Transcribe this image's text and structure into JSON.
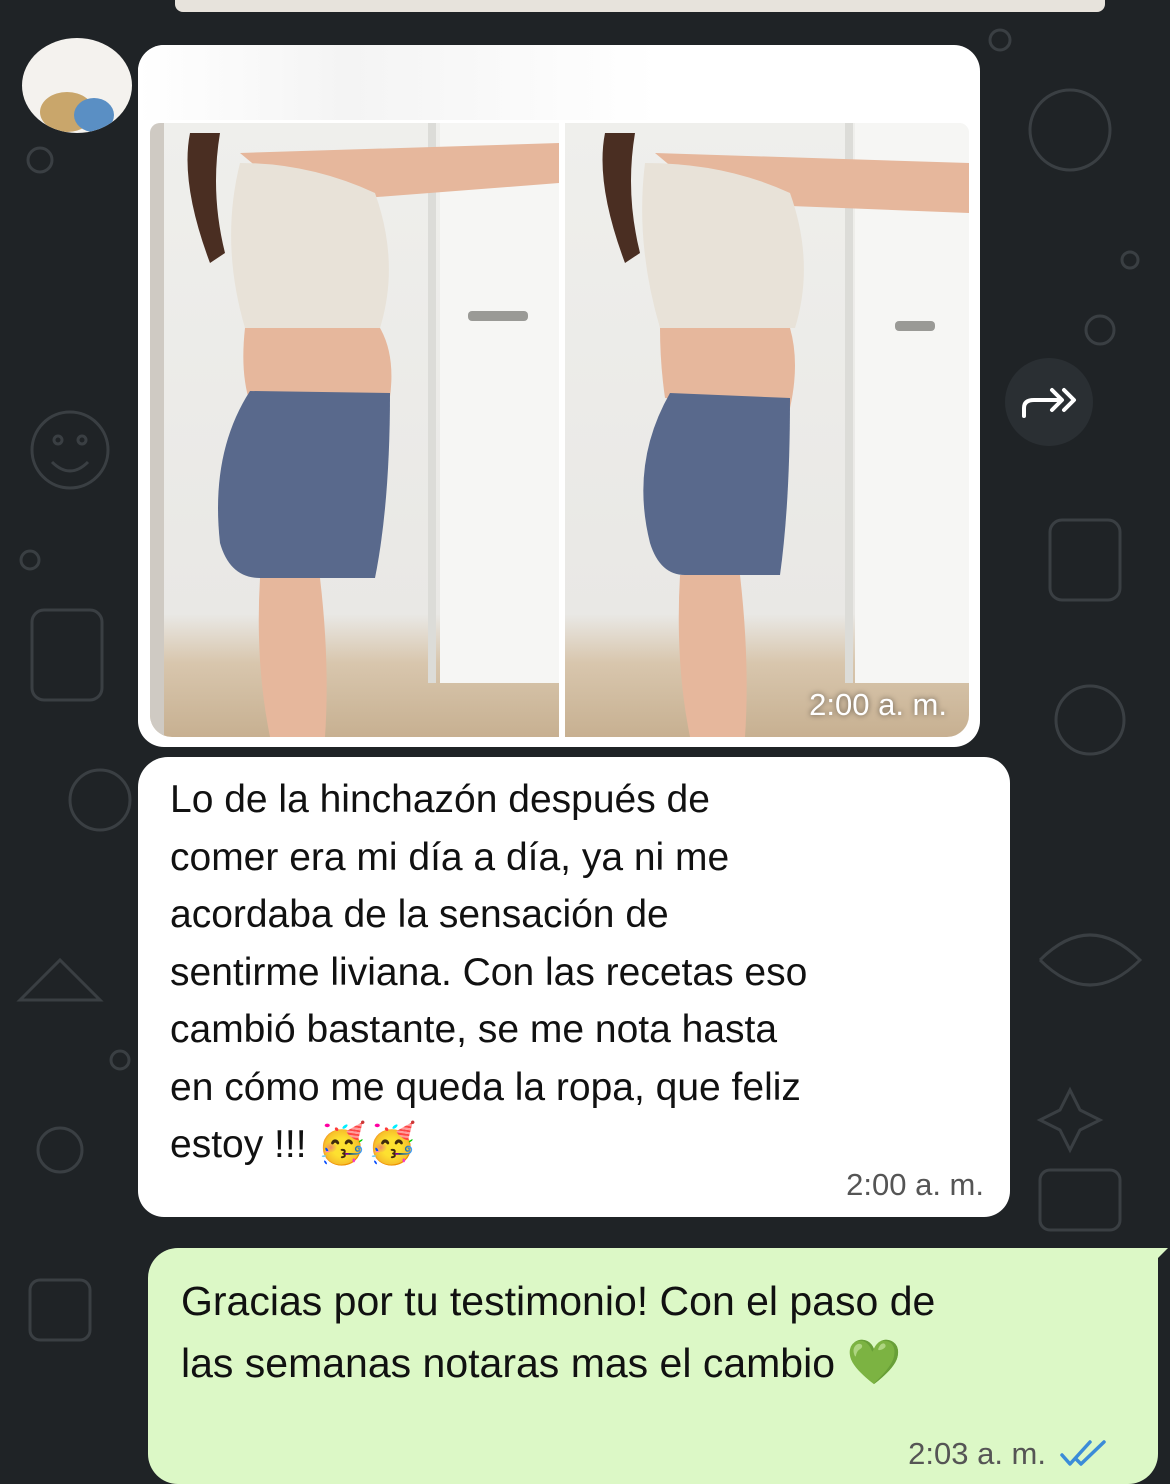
{
  "media_message": {
    "timestamp": "2:00 a. m."
  },
  "incoming_message": {
    "lines": [
      "Lo de la hinchazón después de",
      "comer era mi día a día, ya ni me",
      "acordaba de la sensación de",
      "sentirme liviana. Con las recetas eso",
      "cambió bastante, se me nota hasta",
      "en cómo me queda la ropa, que feliz",
      "estoy !!!"
    ],
    "emoji": "🥳🥳",
    "timestamp": "2:00 a. m."
  },
  "outgoing_message": {
    "lines": [
      "Gracias por tu testimonio! Con el paso de",
      "las semanas notaras mas el cambio"
    ],
    "emoji": "💚",
    "timestamp": "2:03 a. m.",
    "status_icon": "double-check-icon"
  },
  "icons": {
    "forward": "forward-icon",
    "read_receipt": "double-check-icon"
  },
  "colors": {
    "background": "#1f2326",
    "incoming_bubble": "#ffffff",
    "outgoing_bubble": "#dcf8c6",
    "read_check": "#3b8cd8",
    "shorts": "#59698c"
  }
}
